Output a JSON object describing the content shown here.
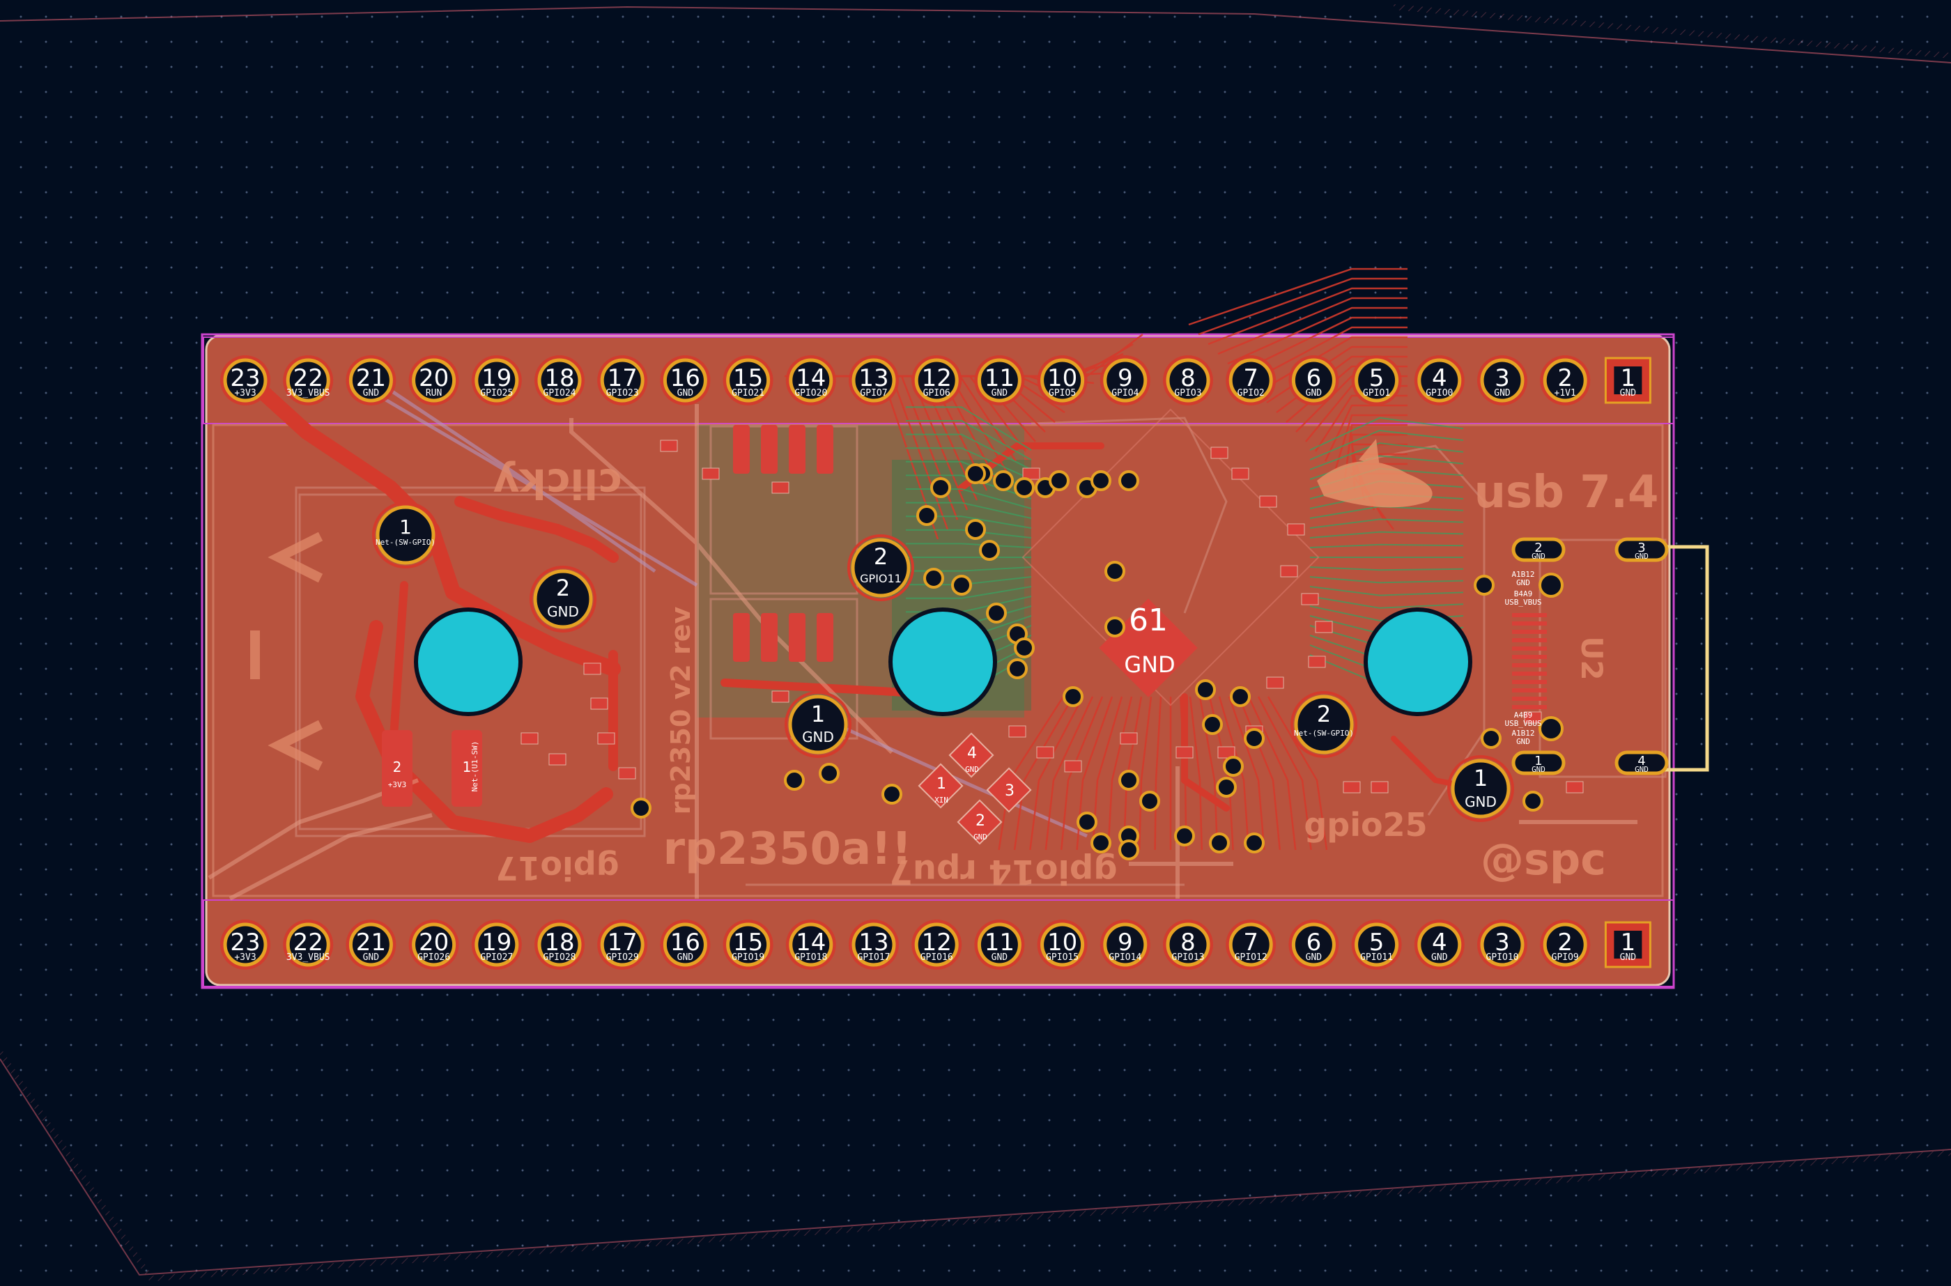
{
  "colors": {
    "background": "#020d1f",
    "board_copper": "#b8533e",
    "copper_bright": "#d43a2c",
    "inner_trace": "#2d8a4a",
    "silk": "#e08a6a",
    "edge_cuts": "#cc44cc",
    "mounting_hole": "#1fc4d4",
    "pad_gold": "#e5a224",
    "connector_outline": "#f4d88a"
  },
  "silkscreen": {
    "clicky": "clicky",
    "usb": "usb 7.4",
    "rp2350": "rp2350a!!",
    "at_spc": "@spc",
    "gpio25": "gpio25",
    "gpio17": "gpio17",
    "gpio14": "gpio14 rpu7",
    "vertical_label": "rp2350 v2 rev"
  },
  "header_top": [
    {
      "num": "23",
      "net": "+3V3"
    },
    {
      "num": "22",
      "net": "3V3_VBUS"
    },
    {
      "num": "21",
      "net": "GND"
    },
    {
      "num": "20",
      "net": "RUN"
    },
    {
      "num": "19",
      "net": "GPIO25"
    },
    {
      "num": "18",
      "net": "GPIO24"
    },
    {
      "num": "17",
      "net": "GPIO23"
    },
    {
      "num": "16",
      "net": "GND"
    },
    {
      "num": "15",
      "net": "GPIO21"
    },
    {
      "num": "14",
      "net": "GPIO20"
    },
    {
      "num": "13",
      "net": "GPIO7"
    },
    {
      "num": "12",
      "net": "GPIO6"
    },
    {
      "num": "11",
      "net": "GND"
    },
    {
      "num": "10",
      "net": "GPIO5"
    },
    {
      "num": "9",
      "net": "GPIO4"
    },
    {
      "num": "8",
      "net": "GPIO3"
    },
    {
      "num": "7",
      "net": "GPIO2"
    },
    {
      "num": "6",
      "net": "GND"
    },
    {
      "num": "5",
      "net": "GPIO1"
    },
    {
      "num": "4",
      "net": "GPIO0"
    },
    {
      "num": "3",
      "net": "GND"
    },
    {
      "num": "2",
      "net": "+1V1"
    },
    {
      "num": "1",
      "net": "GND"
    }
  ],
  "header_bottom": [
    {
      "num": "23",
      "net": "+3V3"
    },
    {
      "num": "22",
      "net": "3V3_VBUS"
    },
    {
      "num": "21",
      "net": "GND"
    },
    {
      "num": "20",
      "net": "GPIO26"
    },
    {
      "num": "19",
      "net": "GPIO27"
    },
    {
      "num": "18",
      "net": "GPIO28"
    },
    {
      "num": "17",
      "net": "GPIO29"
    },
    {
      "num": "16",
      "net": "GND"
    },
    {
      "num": "15",
      "net": "GPIO19"
    },
    {
      "num": "14",
      "net": "GPIO18"
    },
    {
      "num": "13",
      "net": "GPIO17"
    },
    {
      "num": "12",
      "net": "GPIO16"
    },
    {
      "num": "11",
      "net": "GND"
    },
    {
      "num": "10",
      "net": "GPIO15"
    },
    {
      "num": "9",
      "net": "GPIO14"
    },
    {
      "num": "8",
      "net": "GPIO13"
    },
    {
      "num": "7",
      "net": "GPIO12"
    },
    {
      "num": "6",
      "net": "GND"
    },
    {
      "num": "5",
      "net": "GPIO11"
    },
    {
      "num": "4",
      "net": "GND"
    },
    {
      "num": "3",
      "net": "GPIO10"
    },
    {
      "num": "2",
      "net": "GPIO9"
    },
    {
      "num": "1",
      "net": "GND"
    }
  ],
  "pads": {
    "sw1_1": {
      "num": "1",
      "net": "Net-(SW-GPIO)"
    },
    "sw1_2": {
      "num": "2",
      "net": "GND"
    },
    "sw2_2": {
      "num": "2",
      "net": "GPIO11"
    },
    "sw2_1": {
      "num": "1",
      "net": "GND"
    },
    "sw3_2": {
      "num": "2",
      "net": "Net-(SW-GPIO)"
    },
    "sw3_1": {
      "num": "1",
      "net": "GND"
    },
    "mcu_ep": {
      "num": "61",
      "net": "GND"
    },
    "xtal_4": {
      "num": "4",
      "net": "GND"
    },
    "xtal_1": {
      "num": "1",
      "net": "XIN"
    },
    "xtal_3": {
      "num": "3",
      "net": ""
    },
    "xtal_2": {
      "num": "2",
      "net": "GND"
    },
    "reg_2": {
      "num": "2",
      "net": "+3V3"
    },
    "reg_1": {
      "num": "1",
      "net": "Net-(U1-SW)"
    },
    "usb_a": {
      "num": "2",
      "net": "GND"
    },
    "usb_b": {
      "num": "3",
      "net": "GND"
    },
    "usb_c": {
      "num": "1",
      "net": "GND"
    },
    "usb_d": {
      "num": "4",
      "net": "GND"
    },
    "usb_shield": {
      "num": "1",
      "net": "GND"
    }
  },
  "usb_labels": [
    "A1B12",
    "GND",
    "B4A9",
    "USB_VBUS",
    "A4B9",
    "USB_VBUS",
    "A1B12",
    "GND"
  ],
  "rotated_label": "U2",
  "power_symbols": [
    "V",
    "–",
    "V"
  ]
}
